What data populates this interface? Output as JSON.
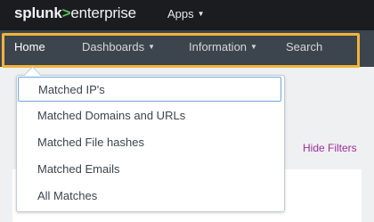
{
  "header": {
    "logo": {
      "part1": "splunk",
      "part2": ">",
      "part3": "enterprise"
    },
    "apps_label": "Apps"
  },
  "nav": {
    "home": "Home",
    "dashboards": "Dashboards",
    "information": "Information",
    "search": "Search"
  },
  "dropdown": {
    "items": [
      "Matched IP's",
      "Matched Domains and URLs",
      "Matched File hashes",
      "Matched Emails",
      "All Matches"
    ]
  },
  "page": {
    "hide_filters": "Hide Filters"
  },
  "colors": {
    "highlight_border": "#f0b43a",
    "link": "#9c2f97",
    "accent_green": "#65a637",
    "nav_bg": "#3c444d",
    "topbar_bg": "#1a1c20"
  }
}
